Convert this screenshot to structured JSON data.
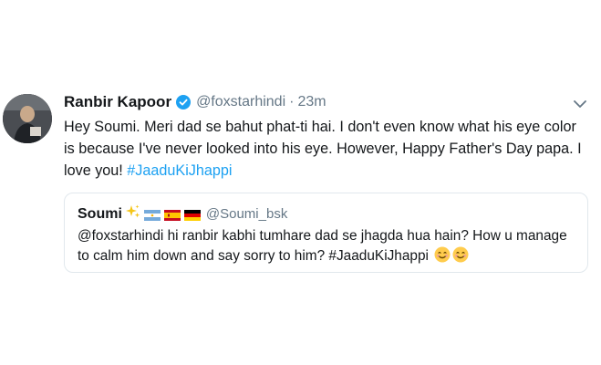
{
  "tweet": {
    "author_name": "Ranbir Kapoor",
    "handle": "@foxstarhindi",
    "separator": "·",
    "time": "23m",
    "text": "Hey Soumi. Meri dad se bahut phat-ti hai. I don't even know what his eye color is because I've never looked into his eye. However, Happy Father's Day papa. I love you!",
    "hashtag": "#JaaduKiJhappi"
  },
  "quoted": {
    "author_name": "Soumi",
    "handle": "@Soumi_bsk",
    "text": "@foxstarhindi hi ranbir kabhi tumhare dad se jhagda hua hain? How u manage to calm him down and say sorry to him? #JaaduKiJhappi"
  },
  "icons": {
    "verified": "verified-badge-icon",
    "menu": "chevron-down-icon",
    "sparkles": "sparkles-icon",
    "flags": [
      "argentina-flag-icon",
      "spain-flag-icon",
      "germany-flag-icon"
    ],
    "emoji": "smiling-face-icon"
  },
  "colors": {
    "accent": "#1da1f2",
    "muted": "#657786",
    "text": "#14171a",
    "border": "#e1e8ed"
  }
}
